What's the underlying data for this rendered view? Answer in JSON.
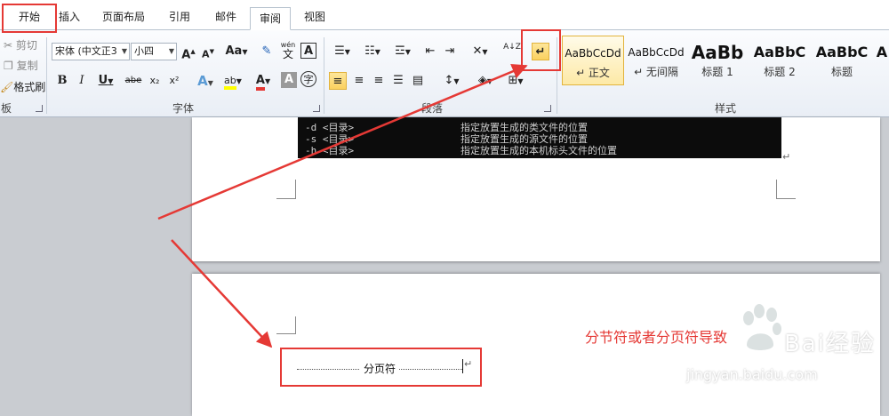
{
  "tabs": [
    {
      "label": "开始",
      "active": false
    },
    {
      "label": "插入",
      "active": false
    },
    {
      "label": "页面布局",
      "active": false
    },
    {
      "label": "引用",
      "active": false
    },
    {
      "label": "邮件",
      "active": false
    },
    {
      "label": "审阅",
      "active": true
    },
    {
      "label": "视图",
      "active": false
    }
  ],
  "clipboard": {
    "cut": "剪切",
    "copy": "复制",
    "format_painter": "格式刷",
    "group_label": "板"
  },
  "font": {
    "name": "宋体 (中文正3",
    "size": "小四",
    "grow": "A",
    "shrink": "A",
    "case": "Aa",
    "pinyin": "文",
    "wen": "wén",
    "border_char": "A",
    "bold": "B",
    "italic": "I",
    "underline": "U",
    "strike": "abe",
    "subscript": "x₂",
    "superscript": "x²",
    "effects": "A",
    "highlight": "ab",
    "font_color": "A",
    "shading": "A",
    "enclose": "字",
    "group_label": "字体"
  },
  "paragraph": {
    "group_label": "段落",
    "sort": "A↓Z"
  },
  "styles": {
    "group_label": "样式",
    "items": [
      {
        "sample": "AaBbCcDd",
        "label": "↵ 正文",
        "selected": true
      },
      {
        "sample": "AaBbCcDd",
        "label": "↵ 无间隔",
        "selected": false
      },
      {
        "sample": "AaBb",
        "label": "标题 1",
        "selected": false
      },
      {
        "sample": "AaBbC",
        "label": "标题 2",
        "selected": false
      },
      {
        "sample": "AaBbC",
        "label": "标题",
        "selected": false
      },
      {
        "sample": "A",
        "label": "",
        "selected": false
      }
    ]
  },
  "console": {
    "rows": [
      {
        "flag": "-d <目录>",
        "desc": "指定放置生成的类文件的位置"
      },
      {
        "flag": "-s <目录>",
        "desc": "指定放置生成的源文件的位置"
      },
      {
        "flag": "-h <目录>",
        "desc": "指定放置生成的本机标头文件的位置"
      }
    ]
  },
  "document": {
    "page_break_label": "分页符",
    "paragraph_mark": "↵"
  },
  "annotation": {
    "caption": "分节符或者分页符导致"
  },
  "watermark": {
    "brand": "Bai经验",
    "url": "jingyan.baidu.com"
  },
  "colors": {
    "accent_red": "#e53935",
    "highlight_yellow": "#fbd15f"
  }
}
